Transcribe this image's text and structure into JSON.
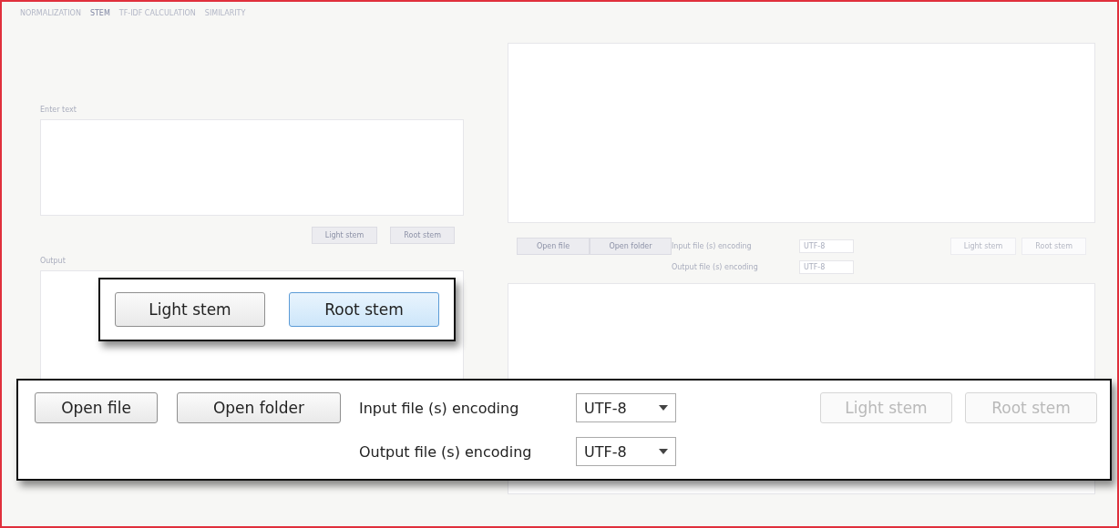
{
  "tabs": [
    {
      "label": "NORMALIZATION",
      "selected": false
    },
    {
      "label": "STEM",
      "selected": true
    },
    {
      "label": "TF-IDF CALCULATION",
      "selected": false
    },
    {
      "label": "SIMILARITY",
      "selected": false
    }
  ],
  "text_panel": {
    "input_label": "Enter text",
    "buttons": [
      {
        "label": "Light stem"
      },
      {
        "label": "Root stem"
      }
    ],
    "output_label": "Output"
  },
  "file_panel": {
    "buttons": [
      "Open file",
      "Open folder"
    ],
    "encodings": [
      {
        "label": "Input file (s) encoding",
        "value": "UTF-8"
      },
      {
        "label": "Output file (s) encoding",
        "value": "UTF-8"
      }
    ],
    "stem_buttons": [
      {
        "label": "Light stem",
        "disabled": true
      },
      {
        "label": "Root stem",
        "disabled": true
      }
    ]
  },
  "stem_callout": {
    "buttons": [
      {
        "label": "Light stem",
        "selected": false
      },
      {
        "label": "Root stem",
        "selected": true
      }
    ]
  },
  "file_callout": {
    "buttons": [
      "Open file",
      "Open folder"
    ],
    "encodings": [
      {
        "label": "Input file (s) encoding",
        "value": "UTF-8"
      },
      {
        "label": "Output file (s) encoding",
        "value": "UTF-8"
      }
    ],
    "stem_buttons": [
      {
        "label": "Light stem",
        "disabled": true
      },
      {
        "label": "Root stem",
        "disabled": true
      }
    ]
  }
}
